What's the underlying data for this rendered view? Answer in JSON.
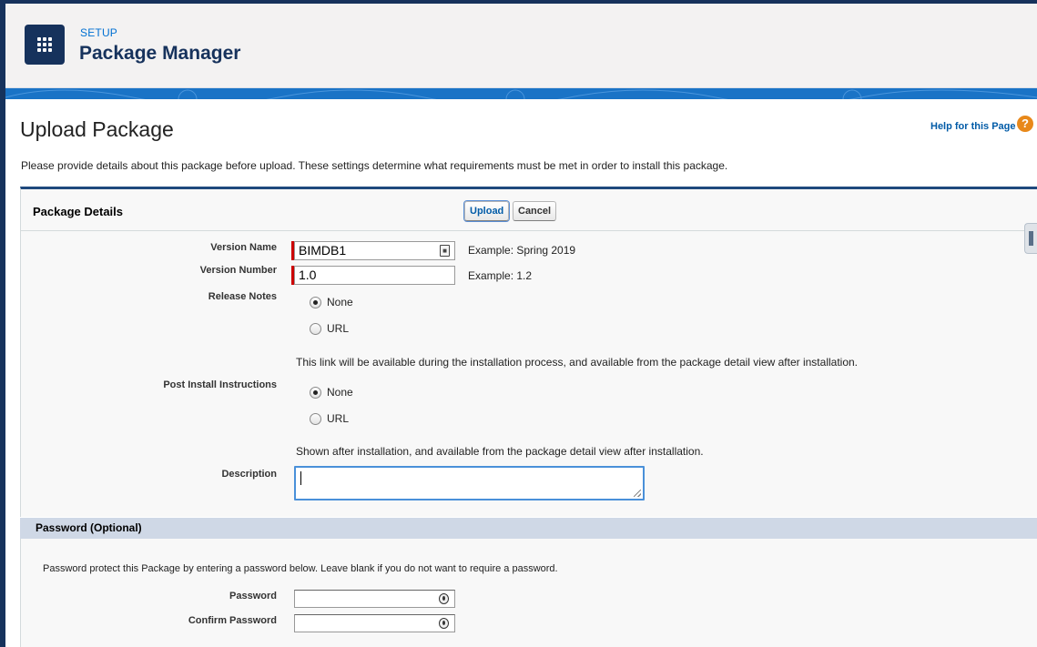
{
  "header": {
    "breadcrumb": "SETUP",
    "title": "Package Manager",
    "app_icon": "app-launcher-grid-icon"
  },
  "page": {
    "title": "Upload Package",
    "help_link": "Help for this Page",
    "help_icon": "?",
    "intro": "Please provide details about this package before upload. These settings determine what requirements must be met in order to install this package."
  },
  "package_details": {
    "section_title": "Package Details",
    "upload_label": "Upload",
    "cancel_label": "Cancel",
    "version_name": {
      "label": "Version Name",
      "value": "BIMDB1",
      "example": "Example: Spring 2019"
    },
    "version_number": {
      "label": "Version Number",
      "value": "1.0",
      "example": "Example: 1.2"
    },
    "release_notes": {
      "label": "Release Notes",
      "options": [
        "None",
        "URL"
      ],
      "selected": "None",
      "note": "This link will be available during the installation process, and available from the package detail view after installation."
    },
    "post_install": {
      "label": "Post Install Instructions",
      "options": [
        "None",
        "URL"
      ],
      "selected": "None",
      "note": "Shown after installation, and available from the package detail view after installation."
    },
    "description": {
      "label": "Description",
      "value": ""
    }
  },
  "password_section": {
    "title": "Password (Optional)",
    "intro": "Password protect this Package by entering a password below. Leave blank if you do not want to require a password.",
    "password_label": "Password",
    "confirm_label": "Confirm Password",
    "password_value": "",
    "confirm_value": ""
  },
  "colors": {
    "accent": "#16325c",
    "link": "#0070d2",
    "required": "#cc0000",
    "section_bar": "#cfd8e6"
  }
}
